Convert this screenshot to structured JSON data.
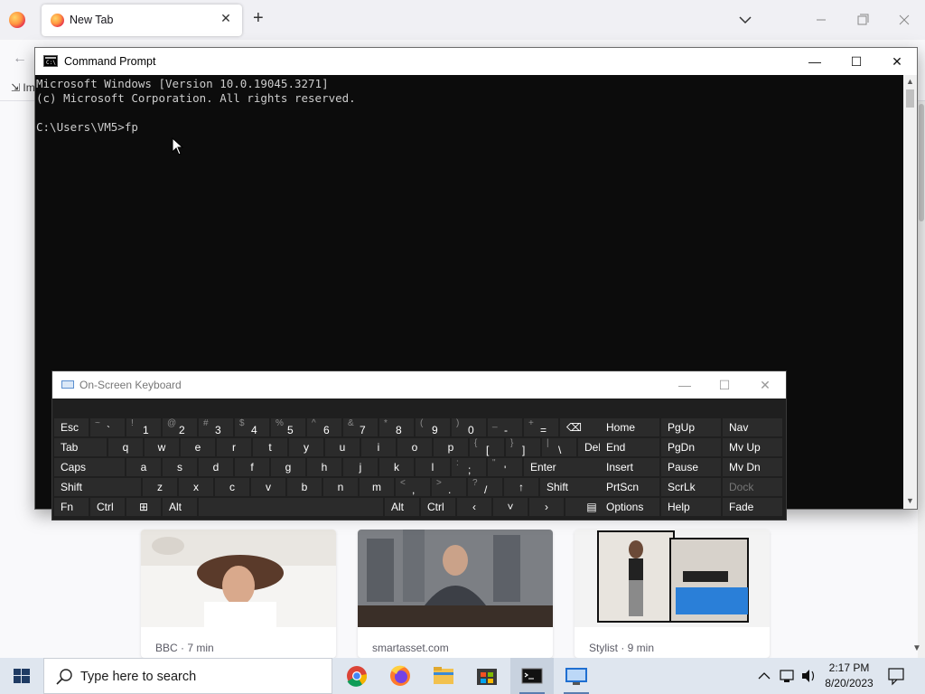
{
  "browser": {
    "tab_title": "New Tab",
    "tab_close": "✕",
    "new_tab": "+",
    "back": "←",
    "import_label": "Im"
  },
  "cards": [
    {
      "source": "BBC · 7 min"
    },
    {
      "source": "smartasset.com"
    },
    {
      "source": "Stylist · 9 min"
    }
  ],
  "cmd": {
    "title": "Command Prompt",
    "icon_text": "C:\\",
    "minimize": "—",
    "maximize": "☐",
    "close": "✕",
    "lines": [
      "Microsoft Windows [Version 10.0.19045.3271]",
      "(c) Microsoft Corporation. All rights reserved.",
      "",
      "C:\\Users\\VM5>fp"
    ]
  },
  "osk": {
    "title": "On-Screen Keyboard",
    "minimize": "—",
    "maximize": "☐",
    "close": "✕",
    "rows": {
      "r1": [
        {
          "main": "Esc"
        },
        {
          "shift": "~",
          "main": "`"
        },
        {
          "shift": "!",
          "main": "1"
        },
        {
          "shift": "@",
          "main": "2"
        },
        {
          "shift": "#",
          "main": "3"
        },
        {
          "shift": "$",
          "main": "4"
        },
        {
          "shift": "%",
          "main": "5"
        },
        {
          "shift": "^",
          "main": "6"
        },
        {
          "shift": "&",
          "main": "7"
        },
        {
          "shift": "*",
          "main": "8"
        },
        {
          "shift": "(",
          "main": "9"
        },
        {
          "shift": ")",
          "main": "0"
        },
        {
          "shift": "_",
          "main": "-"
        },
        {
          "shift": "+",
          "main": "="
        },
        {
          "main": "⌫"
        }
      ],
      "r2": [
        "Tab",
        "q",
        "w",
        "e",
        "r",
        "t",
        "y",
        "u",
        "i",
        "o",
        "p",
        {
          "shift": "{",
          "main": "["
        },
        {
          "shift": "}",
          "main": "]"
        },
        {
          "shift": "|",
          "main": "\\"
        },
        "Del"
      ],
      "r3": [
        "Caps",
        "a",
        "s",
        "d",
        "f",
        "g",
        "h",
        "j",
        "k",
        "l",
        {
          "shift": ":",
          "main": ";"
        },
        {
          "shift": "\"",
          "main": "'"
        },
        "Enter"
      ],
      "r4": [
        "Shift",
        "z",
        "x",
        "c",
        "v",
        "b",
        "n",
        "m",
        {
          "shift": "<",
          "main": ","
        },
        {
          "shift": ">",
          "main": "."
        },
        {
          "shift": "?",
          "main": "/"
        },
        "↑",
        "Shift"
      ],
      "r5": [
        "Fn",
        "Ctrl",
        "⊞",
        "Alt",
        "",
        "Alt",
        "Ctrl",
        "‹",
        "˅",
        "›",
        "▤"
      ]
    },
    "nav": [
      [
        "Home",
        "PgUp",
        "Nav"
      ],
      [
        "End",
        "PgDn",
        "Mv Up"
      ],
      [
        "Insert",
        "Pause",
        "Mv Dn"
      ],
      [
        "PrtScn",
        "ScrLk",
        "Dock"
      ],
      [
        "Options",
        "Help",
        "Fade"
      ]
    ]
  },
  "taskbar": {
    "search_placeholder": "Type here to search",
    "apps": [
      "chrome-icon",
      "firefox-icon",
      "file-explorer-icon",
      "store-icon",
      "cmd-icon",
      "remote-desktop-icon"
    ],
    "time": "2:17 PM",
    "date": "8/20/2023"
  }
}
